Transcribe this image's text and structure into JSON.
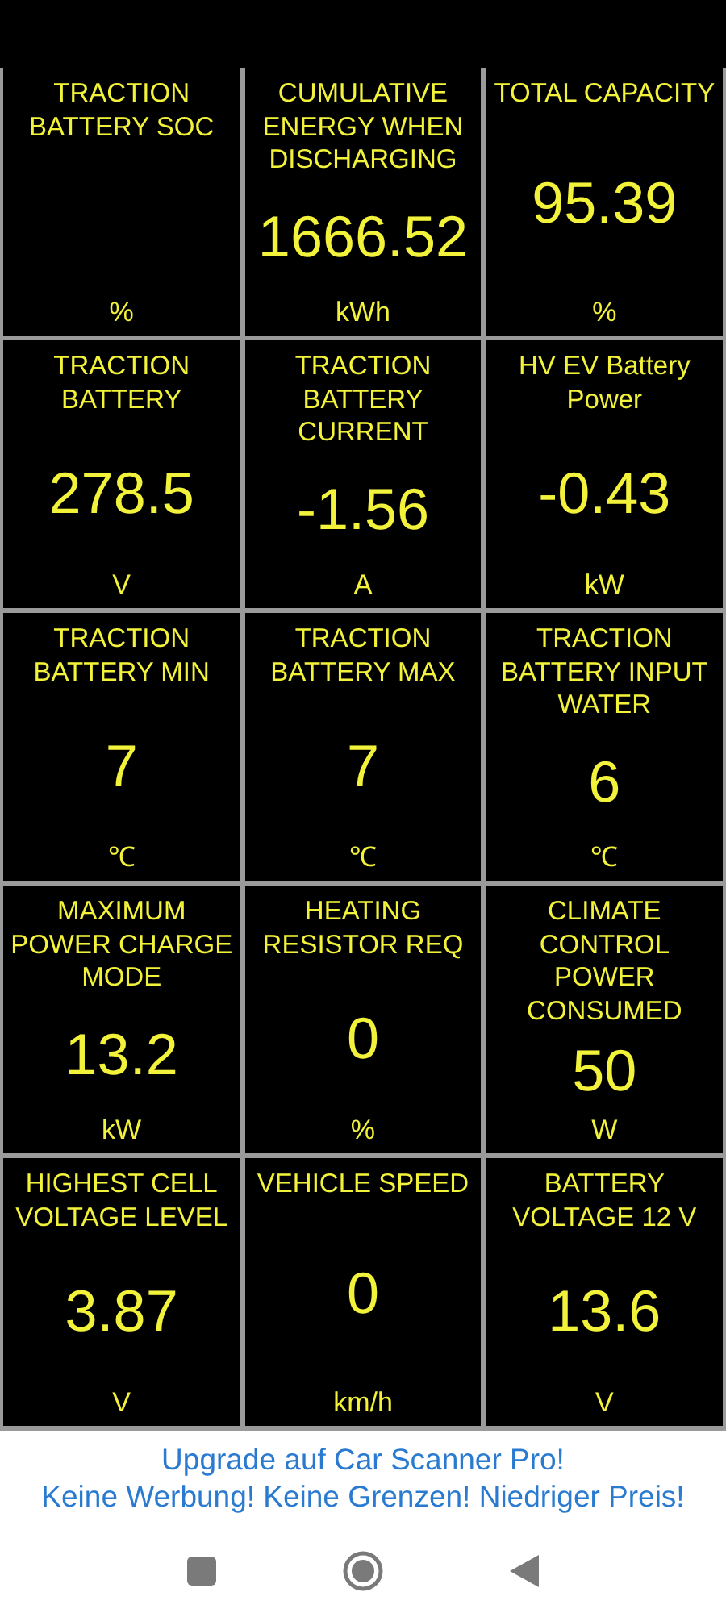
{
  "gauges": [
    {
      "title": "TRACTION BATTERY SOC",
      "unit": "%"
    },
    {
      "title": "CUMULATIVE ENERGY WHEN DISCHARGING",
      "value": "1666.52",
      "unit": "kWh"
    },
    {
      "title": "TOTAL CAPACITY",
      "value": "95.39",
      "unit": "%"
    },
    {
      "title": "TRACTION BATTERY",
      "value": "278.5",
      "unit": "V"
    },
    {
      "title": "TRACTION BATTERY CURRENT",
      "value": "-1.56",
      "unit": "A"
    },
    {
      "title": "HV EV Battery Power",
      "value": "-0.43",
      "unit": "kW"
    },
    {
      "title": "TRACTION BATTERY MIN",
      "value": "7",
      "unit": "℃"
    },
    {
      "title": "TRACTION BATTERY MAX",
      "value": "7",
      "unit": "℃"
    },
    {
      "title": "TRACTION BATTERY INPUT WATER",
      "value": "6",
      "unit": "℃"
    },
    {
      "title": "MAXIMUM POWER CHARGE MODE",
      "value": "13.2",
      "unit": "kW"
    },
    {
      "title": "HEATING RESISTOR REQ",
      "value": "0",
      "unit": "%"
    },
    {
      "title": "CLIMATE CONTROL POWER CONSUMED",
      "value": "50",
      "unit": "W"
    },
    {
      "title": "HIGHEST CELL VOLTAGE LEVEL",
      "value": "3.87",
      "unit": "V"
    },
    {
      "title": "VEHICLE SPEED",
      "value": "0",
      "unit": "km/h"
    },
    {
      "title": "BATTERY VOLTAGE 12 V",
      "value": "13.6",
      "unit": "V"
    }
  ],
  "ad": {
    "lines": [
      "Upgrade auf Car Scanner Pro!",
      "Keine Werbung! Keine Grenzen! Niedriger Preis!"
    ]
  }
}
